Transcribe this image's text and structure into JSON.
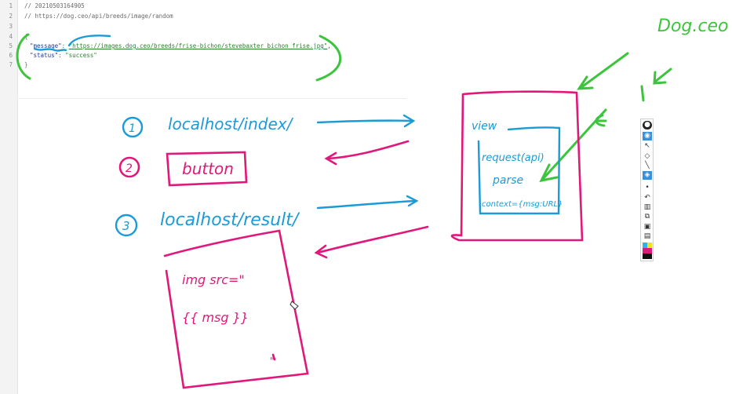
{
  "editor": {
    "line_numbers": [
      "1",
      "2",
      "3",
      "4",
      "5",
      "6",
      "7"
    ],
    "line1": "// 20210503164905",
    "line2": "// https://dog.ceo/api/breeds/image/random",
    "line4": "{",
    "line5": {
      "key": "\"message\"",
      "colon": ": ",
      "value": "\"https://images.dog.ceo/breeds/frise-bichon/stevebaxter_bichon_frise.jpg\"",
      "comma": ","
    },
    "line6": {
      "key": "\"status\"",
      "colon": ": ",
      "value": "\"success\""
    },
    "line7": "}"
  },
  "whiteboard": {
    "step1": {
      "number": "1",
      "text": "localhost/index/"
    },
    "step2": {
      "number": "2",
      "text": "button"
    },
    "step3": {
      "number": "3",
      "text": "localhost/result/"
    },
    "result_box": {
      "line1": "img src=\"",
      "line2": "{{ msg }}",
      "line3": "\""
    },
    "view_box": {
      "label": "view",
      "line1": "request(api)",
      "line2": "parse",
      "line3": "context={msg:URL}"
    },
    "dog_ceo": "Dog.ceo"
  },
  "colors": {
    "blue": "#1a9bd8",
    "pink": "#e0187a",
    "green": "#3cc43c"
  },
  "toolbar": {
    "tools": [
      "bulb-icon",
      "eye-icon",
      "pointer-icon",
      "eraser-icon",
      "pen-icon",
      "highlighter-icon",
      "dot-icon",
      "undo-icon",
      "trash-icon",
      "copy-icon",
      "screenshot-icon",
      "clipboard-icon"
    ]
  }
}
